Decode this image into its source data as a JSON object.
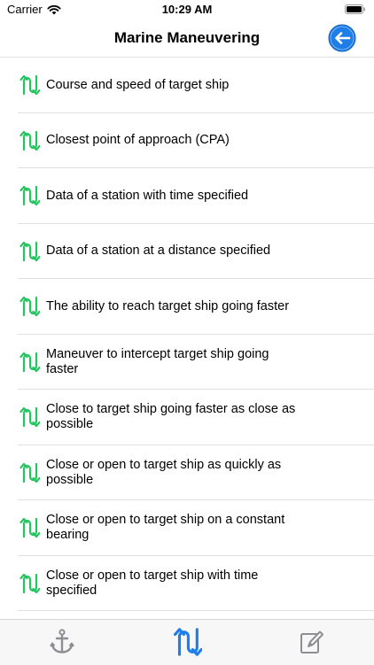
{
  "status_bar": {
    "carrier": "Carrier",
    "time": "10:29 AM"
  },
  "nav": {
    "title": "Marine Maneuvering",
    "back_icon": "back-arrow-circle-icon",
    "accent_color": "#1e7ee8"
  },
  "list": {
    "icon": "maneuver-arrows-icon",
    "icon_color": "#22c55e",
    "items": [
      {
        "label": "Course and speed of target ship"
      },
      {
        "label": "Closest point of approach (CPA)"
      },
      {
        "label": "Data of a station with time specified"
      },
      {
        "label": "Data of a station at a distance specified"
      },
      {
        "label": "The ability to reach target ship going faster"
      },
      {
        "label": "Maneuver to intercept target ship going faster"
      },
      {
        "label": "Close to target ship going faster as close as possible"
      },
      {
        "label": "Close or open to target ship as quickly as possible"
      },
      {
        "label": "Close or open to target ship on a constant bearing"
      },
      {
        "label": "Close or open to target ship with time specified"
      }
    ]
  },
  "tab_bar": {
    "tabs": [
      {
        "icon": "anchor-icon",
        "selected": false
      },
      {
        "icon": "maneuver-arrows-icon",
        "selected": true
      },
      {
        "icon": "edit-note-icon",
        "selected": false
      }
    ],
    "selected_color": "#1e7ee8",
    "unselected_color": "#8e8e93"
  }
}
